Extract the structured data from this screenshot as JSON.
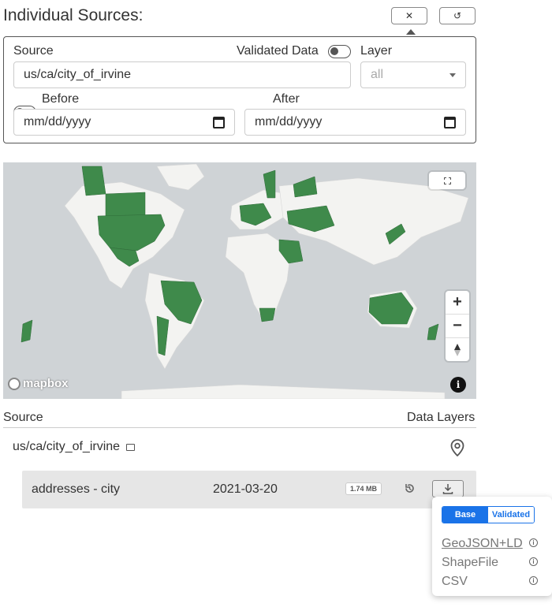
{
  "header": {
    "title": "Individual Sources:",
    "close_icon": "✕",
    "reset_icon": "↺"
  },
  "filters": {
    "source_label": "Source",
    "source_value": "us/ca/city_of_irvine",
    "validated_label": "Validated Data",
    "layer_label": "Layer",
    "layer_value": "all",
    "before_label": "Before",
    "before_value": "mm/dd/yyyy",
    "after_label": "After",
    "after_value": "mm/dd/yyyy"
  },
  "map": {
    "brand": "mapbox",
    "zoom_in": "+",
    "zoom_out": "−",
    "info": "i",
    "land_color": "#f3f3f1",
    "water_color": "#cfd3d6",
    "highlight_color": "#3f8a4b"
  },
  "table": {
    "source_header": "Source",
    "layers_header": "Data Layers",
    "source_name": "us/ca/city_of_irvine",
    "layer": {
      "name": "addresses - city",
      "date": "2021-03-20",
      "size": "1.74 MB"
    }
  },
  "download_popup": {
    "tabs": [
      "Base",
      "Validated"
    ],
    "active_tab": "Base",
    "active_color": "#1a73e8",
    "formats": [
      "GeoJSON+LD",
      "ShapeFile",
      "CSV"
    ]
  }
}
